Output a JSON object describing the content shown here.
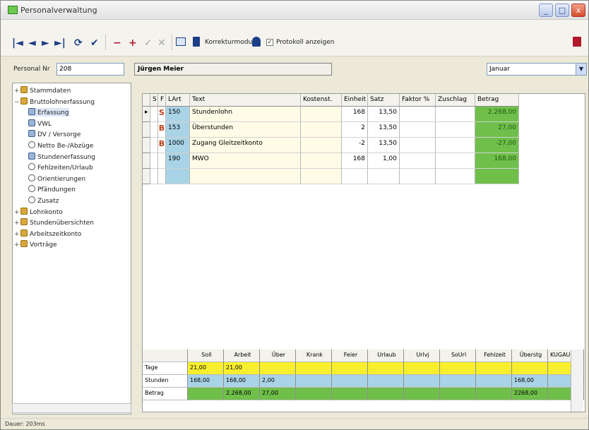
{
  "window": {
    "title": "Personalverwaltung",
    "min_label": "_",
    "max_label": "□",
    "close_label": "x"
  },
  "toolbar": {
    "nav_first": "|◄",
    "nav_prev": "◄",
    "nav_next": "►",
    "nav_last": "►|",
    "refresh": "⟳",
    "confirm": "✔",
    "remove": "−",
    "add": "+",
    "check": "✓",
    "cancel": "✕",
    "korrektur_label": "Korrekturmodus",
    "protokoll_label": "Protokoll anzeigen",
    "protokoll_checked": "✓"
  },
  "filter": {
    "personal_label": "Personal Nr",
    "personal_value": "208",
    "employee_name": "Jürgen Meier",
    "month": "Januar"
  },
  "sidebar": {
    "items": [
      {
        "label": "Stammdaten",
        "expander": "+",
        "level": 0,
        "icon": "people-icon"
      },
      {
        "label": "Bruttolohnerfassung",
        "expander": "−",
        "level": 0,
        "icon": "group-icon"
      },
      {
        "label": "Erfassung",
        "level": 1,
        "icon": "employee-icon",
        "selected": true
      },
      {
        "label": "VWL",
        "level": 1,
        "icon": "employee-icon"
      },
      {
        "label": "DV / Versorge",
        "level": 1,
        "icon": "employee-icon"
      },
      {
        "label": "Netto Be-/Abzüge",
        "level": 1,
        "icon": "gear-icon"
      },
      {
        "label": "Stundenerfassung",
        "level": 1,
        "icon": "employee-icon"
      },
      {
        "label": "Fehlzeiten/Urlaub",
        "level": 1,
        "icon": "gear-icon"
      },
      {
        "label": "Orientierungen",
        "level": 1,
        "icon": "gear-icon"
      },
      {
        "label": "Pfändungen",
        "level": 1,
        "icon": "gear-icon"
      },
      {
        "label": "Zusatz",
        "level": 1,
        "icon": "gear-icon"
      },
      {
        "label": "Lohnkonto",
        "expander": "+",
        "level": 0,
        "icon": "group-icon"
      },
      {
        "label": "Stundenübersichten",
        "expander": "+",
        "level": 0,
        "icon": "group-icon"
      },
      {
        "label": "Arbeitszeitkonto",
        "expander": "+",
        "level": 0,
        "icon": "group-icon"
      },
      {
        "label": "Vorträge",
        "expander": "+",
        "level": 0,
        "icon": "group-icon"
      }
    ]
  },
  "grid": {
    "headers": [
      "S",
      "F",
      "LArt",
      "Text",
      "Kostenst.",
      "Einheit",
      "Satz",
      "Faktor %",
      "Zuschlag",
      "Betrag"
    ],
    "rows": [
      {
        "marker": "▸",
        "code": "S",
        "lart": "150",
        "text": "Stundenlohn",
        "einheit": "168",
        "satz": "13,50",
        "betrag": "2.268,00"
      },
      {
        "marker": "",
        "code": "B",
        "lart": "153",
        "text": "Überstunden",
        "einheit": "2",
        "satz": "13,50",
        "betrag": "27,00"
      },
      {
        "marker": "",
        "code": "B",
        "lart": "1000",
        "text": "Zugang Gleitzeitkonto",
        "einheit": "-2",
        "satz": "13,50",
        "betrag": "-27,00"
      },
      {
        "marker": "",
        "code": "",
        "lart": "190",
        "text": "MWO",
        "einheit": "168",
        "satz": "1,00",
        "betrag": "168,00"
      }
    ]
  },
  "summary": {
    "headers": [
      "Soll",
      "Arbeit",
      "Über",
      "Krank",
      "Feier",
      "Urlaub",
      "Urlvj",
      "SoUrl",
      "Fehlzeit",
      "Überstg",
      "KUGAUS/AD"
    ],
    "rows": [
      {
        "label": "Tage",
        "values": [
          "21,00",
          "21,00",
          "",
          "",
          "",
          "",
          "",
          "",
          "",
          "",
          ""
        ]
      },
      {
        "label": "Stunden",
        "values": [
          "168,00",
          "168,00",
          "2,00",
          "",
          "",
          "",
          "",
          "",
          "",
          "168,00",
          ""
        ]
      },
      {
        "label": "Betrag",
        "values": [
          "",
          "2.268,00",
          "27,00",
          "",
          "",
          "",
          "",
          "",
          "",
          "2268,00",
          ""
        ]
      }
    ]
  },
  "status": {
    "text": "Dauer: 203ms"
  }
}
